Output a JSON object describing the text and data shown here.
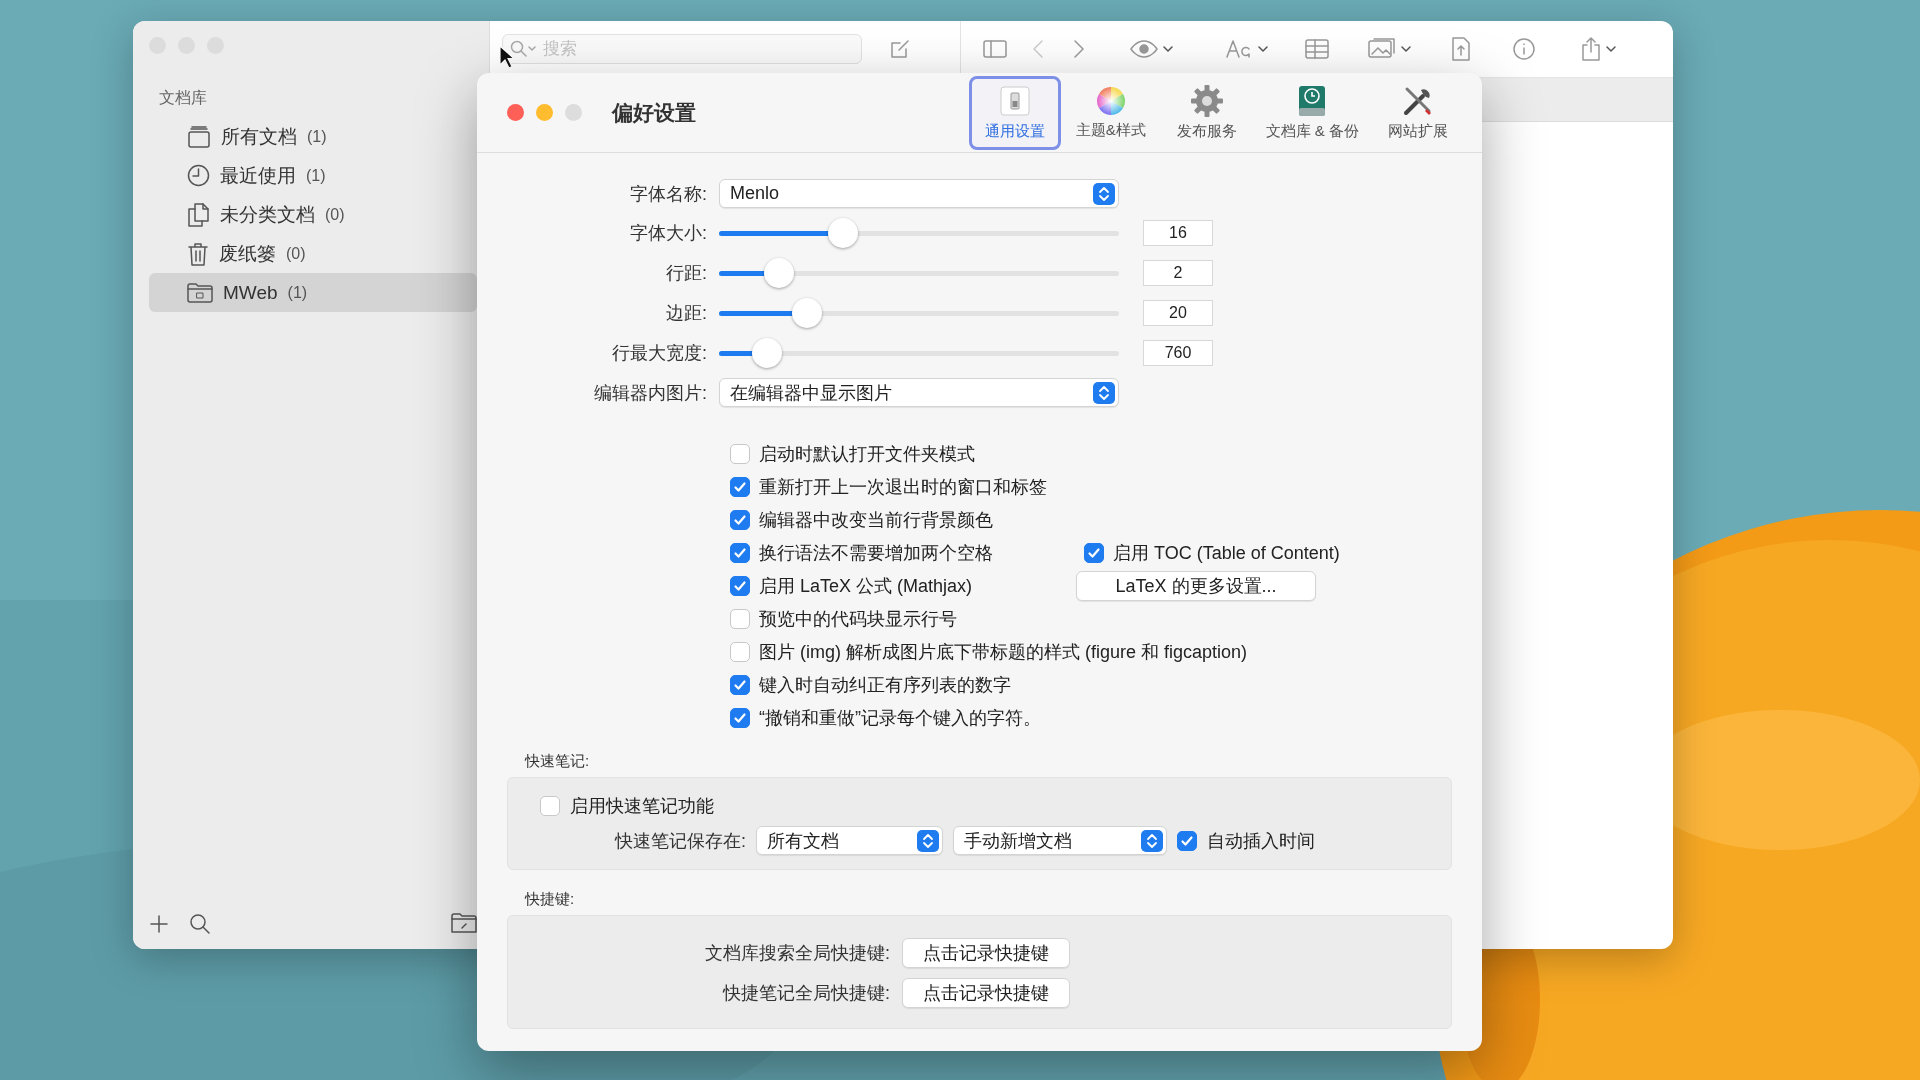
{
  "main_window": {
    "search": {
      "placeholder": "搜索"
    },
    "sidebar": {
      "heading": "文档库",
      "items": [
        {
          "label": "所有文档",
          "count": "(1)",
          "selected": false
        },
        {
          "label": "最近使用",
          "count": "(1)",
          "selected": false
        },
        {
          "label": "未分类文档",
          "count": "(0)",
          "selected": false
        },
        {
          "label": "废纸篓",
          "count": "(0)",
          "selected": false
        },
        {
          "label": "MWeb",
          "count": "(1)",
          "selected": true
        }
      ]
    }
  },
  "preferences": {
    "title": "偏好设置",
    "tabs": [
      {
        "label": "通用设置",
        "selected": true
      },
      {
        "label": "主题&样式",
        "selected": false
      },
      {
        "label": "发布服务",
        "selected": false
      },
      {
        "label": "文档库 & 备份",
        "selected": false
      },
      {
        "label": "网站扩展",
        "selected": false
      }
    ],
    "font_name": {
      "label": "字体名称:",
      "value": "Menlo"
    },
    "sliders": [
      {
        "label": "字体大小:",
        "level": 0.31,
        "reading": "16"
      },
      {
        "label": "行距:",
        "level": 0.15,
        "reading": "2"
      },
      {
        "label": "边距:",
        "level": 0.22,
        "reading": "20"
      },
      {
        "label": "行最大宽度:",
        "level": 0.12,
        "reading": "760"
      }
    ],
    "image_display": {
      "label": "编辑器内图片:",
      "value": "在编辑器中显示图片"
    },
    "options": [
      {
        "label": "启动时默认打开文件夹模式",
        "checked": false
      },
      {
        "label": "重新打开上一次退出时的窗口和标签",
        "checked": true
      },
      {
        "label": "编辑器中改变当前行背景颜色",
        "checked": true
      },
      {
        "label": "换行语法不需要增加两个空格",
        "checked": true
      },
      {
        "label": "启用 LaTeX 公式 (Mathjax)",
        "checked": true
      },
      {
        "label": "预览中的代码块显示行号",
        "checked": false
      },
      {
        "label": "图片 (img) 解析成图片底下带标题的样式 (figure 和 figcaption)",
        "checked": false
      },
      {
        "label": "键入时自动纠正有序列表的数字",
        "checked": true
      },
      {
        "label": "“撤销和重做”记录每个键入的字符。",
        "checked": true
      }
    ],
    "toc": {
      "label": "启用 TOC (Table of Content)",
      "checked": true
    },
    "latex_button": "LaTeX 的更多设置...",
    "quick_note": {
      "heading": "快速笔记:",
      "enable": {
        "label": "启用快速笔记功能",
        "checked": false
      },
      "save_label": "快速笔记保存在:",
      "location": "所有文档",
      "mode": "手动新增文档",
      "auto_time": {
        "label": "自动插入时间",
        "checked": true
      }
    },
    "shortcuts": {
      "heading": "快捷键:",
      "rows": [
        {
          "label": "文档库搜索全局快捷键:",
          "button": "点击记录快捷键"
        },
        {
          "label": "快捷笔记全局快捷键:",
          "button": "点击记录快捷键"
        }
      ]
    }
  }
}
